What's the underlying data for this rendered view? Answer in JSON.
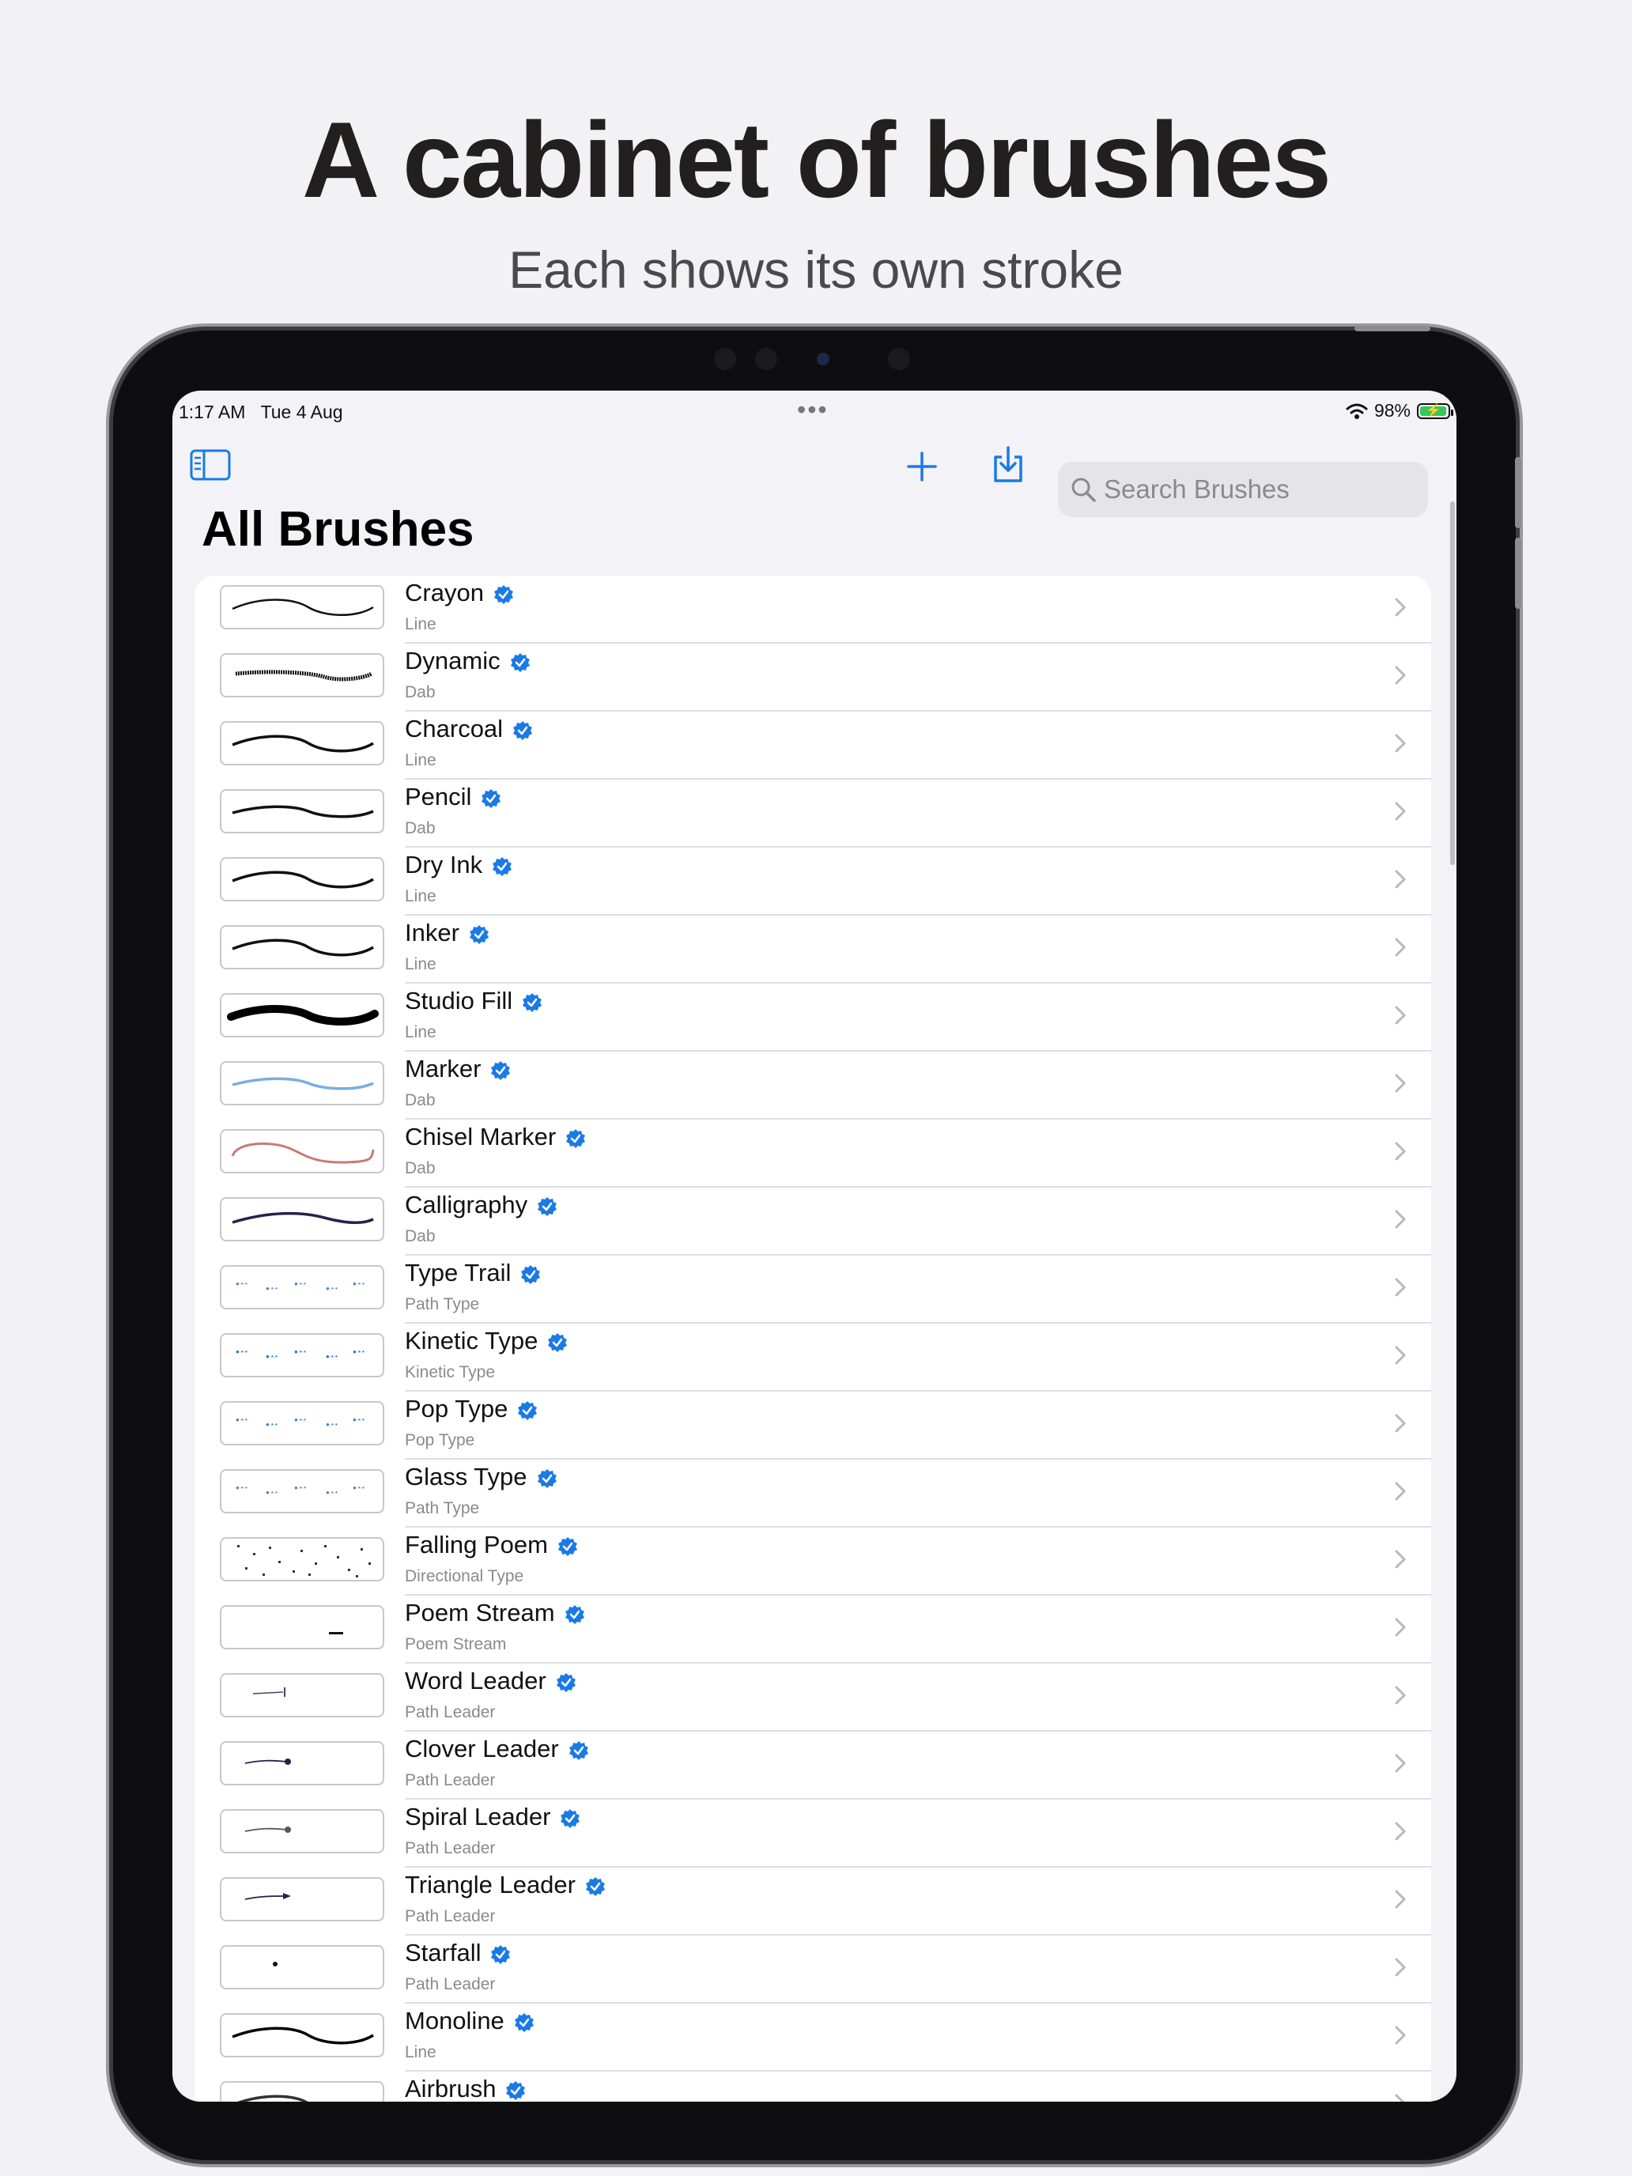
{
  "headline": "A cabinet of brushes",
  "subheadline": "Each shows its own stroke",
  "status_bar": {
    "time": "1:17 AM",
    "date": "Tue 4 Aug",
    "multitasking": "•••",
    "battery_percent": "98%",
    "battery_level": 0.98,
    "charging": true
  },
  "toolbar": {
    "sidebar_icon": "sidebar-icon",
    "add_icon": "plus-icon",
    "import_icon": "import-icon",
    "search_placeholder": "Search Brushes"
  },
  "page_title": "All Brushes",
  "accent_color": "#1a7ae6",
  "brushes": [
    {
      "name": "Crayon",
      "type": "Line",
      "preview": "thin-wave",
      "color": "#111111"
    },
    {
      "name": "Dynamic",
      "type": "Dab",
      "preview": "rough-line",
      "color": "#111111"
    },
    {
      "name": "Charcoal",
      "type": "Line",
      "preview": "wave",
      "color": "#111111"
    },
    {
      "name": "Pencil",
      "type": "Dab",
      "preview": "soft-wave",
      "color": "#111111"
    },
    {
      "name": "Dry Ink",
      "type": "Line",
      "preview": "wave",
      "color": "#111111"
    },
    {
      "name": "Inker",
      "type": "Line",
      "preview": "wave",
      "color": "#111111"
    },
    {
      "name": "Studio Fill",
      "type": "Line",
      "preview": "thick-wave",
      "color": "#000000"
    },
    {
      "name": "Marker",
      "type": "Dab",
      "preview": "soft-wave",
      "color": "#7aaee0"
    },
    {
      "name": "Chisel Marker",
      "type": "Dab",
      "preview": "s-curve",
      "color": "#c87a72"
    },
    {
      "name": "Calligraphy",
      "type": "Dab",
      "preview": "calli",
      "color": "#22244a"
    },
    {
      "name": "Type Trail",
      "type": "Path Type",
      "preview": "type-dots",
      "color": "#4a82c8"
    },
    {
      "name": "Kinetic Type",
      "type": "Kinetic Type",
      "preview": "type-dots",
      "color": "#2a6ec8"
    },
    {
      "name": "Pop Type",
      "type": "Pop Type",
      "preview": "type-dots",
      "color": "#3a7ad0"
    },
    {
      "name": "Glass Type",
      "type": "Path Type",
      "preview": "type-dots",
      "color": "#777777"
    },
    {
      "name": "Falling Poem",
      "type": "Directional Type",
      "preview": "scatter",
      "color": "#333333"
    },
    {
      "name": "Poem Stream",
      "type": "Poem Stream",
      "preview": "small-text",
      "color": "#111111"
    },
    {
      "name": "Word Leader",
      "type": "Path Leader",
      "preview": "leader-bar",
      "color": "#444466"
    },
    {
      "name": "Clover Leader",
      "type": "Path Leader",
      "preview": "leader-dot",
      "color": "#22244a"
    },
    {
      "name": "Spiral Leader",
      "type": "Path Leader",
      "preview": "leader-dot",
      "color": "#555566"
    },
    {
      "name": "Triangle Leader",
      "type": "Path Leader",
      "preview": "leader-arrow",
      "color": "#22244a"
    },
    {
      "name": "Starfall",
      "type": "Path Leader",
      "preview": "dot",
      "color": "#111111"
    },
    {
      "name": "Monoline",
      "type": "Line",
      "preview": "wave",
      "color": "#000000"
    },
    {
      "name": "Airbrush",
      "type": "",
      "preview": "wave",
      "color": "#333333"
    }
  ]
}
